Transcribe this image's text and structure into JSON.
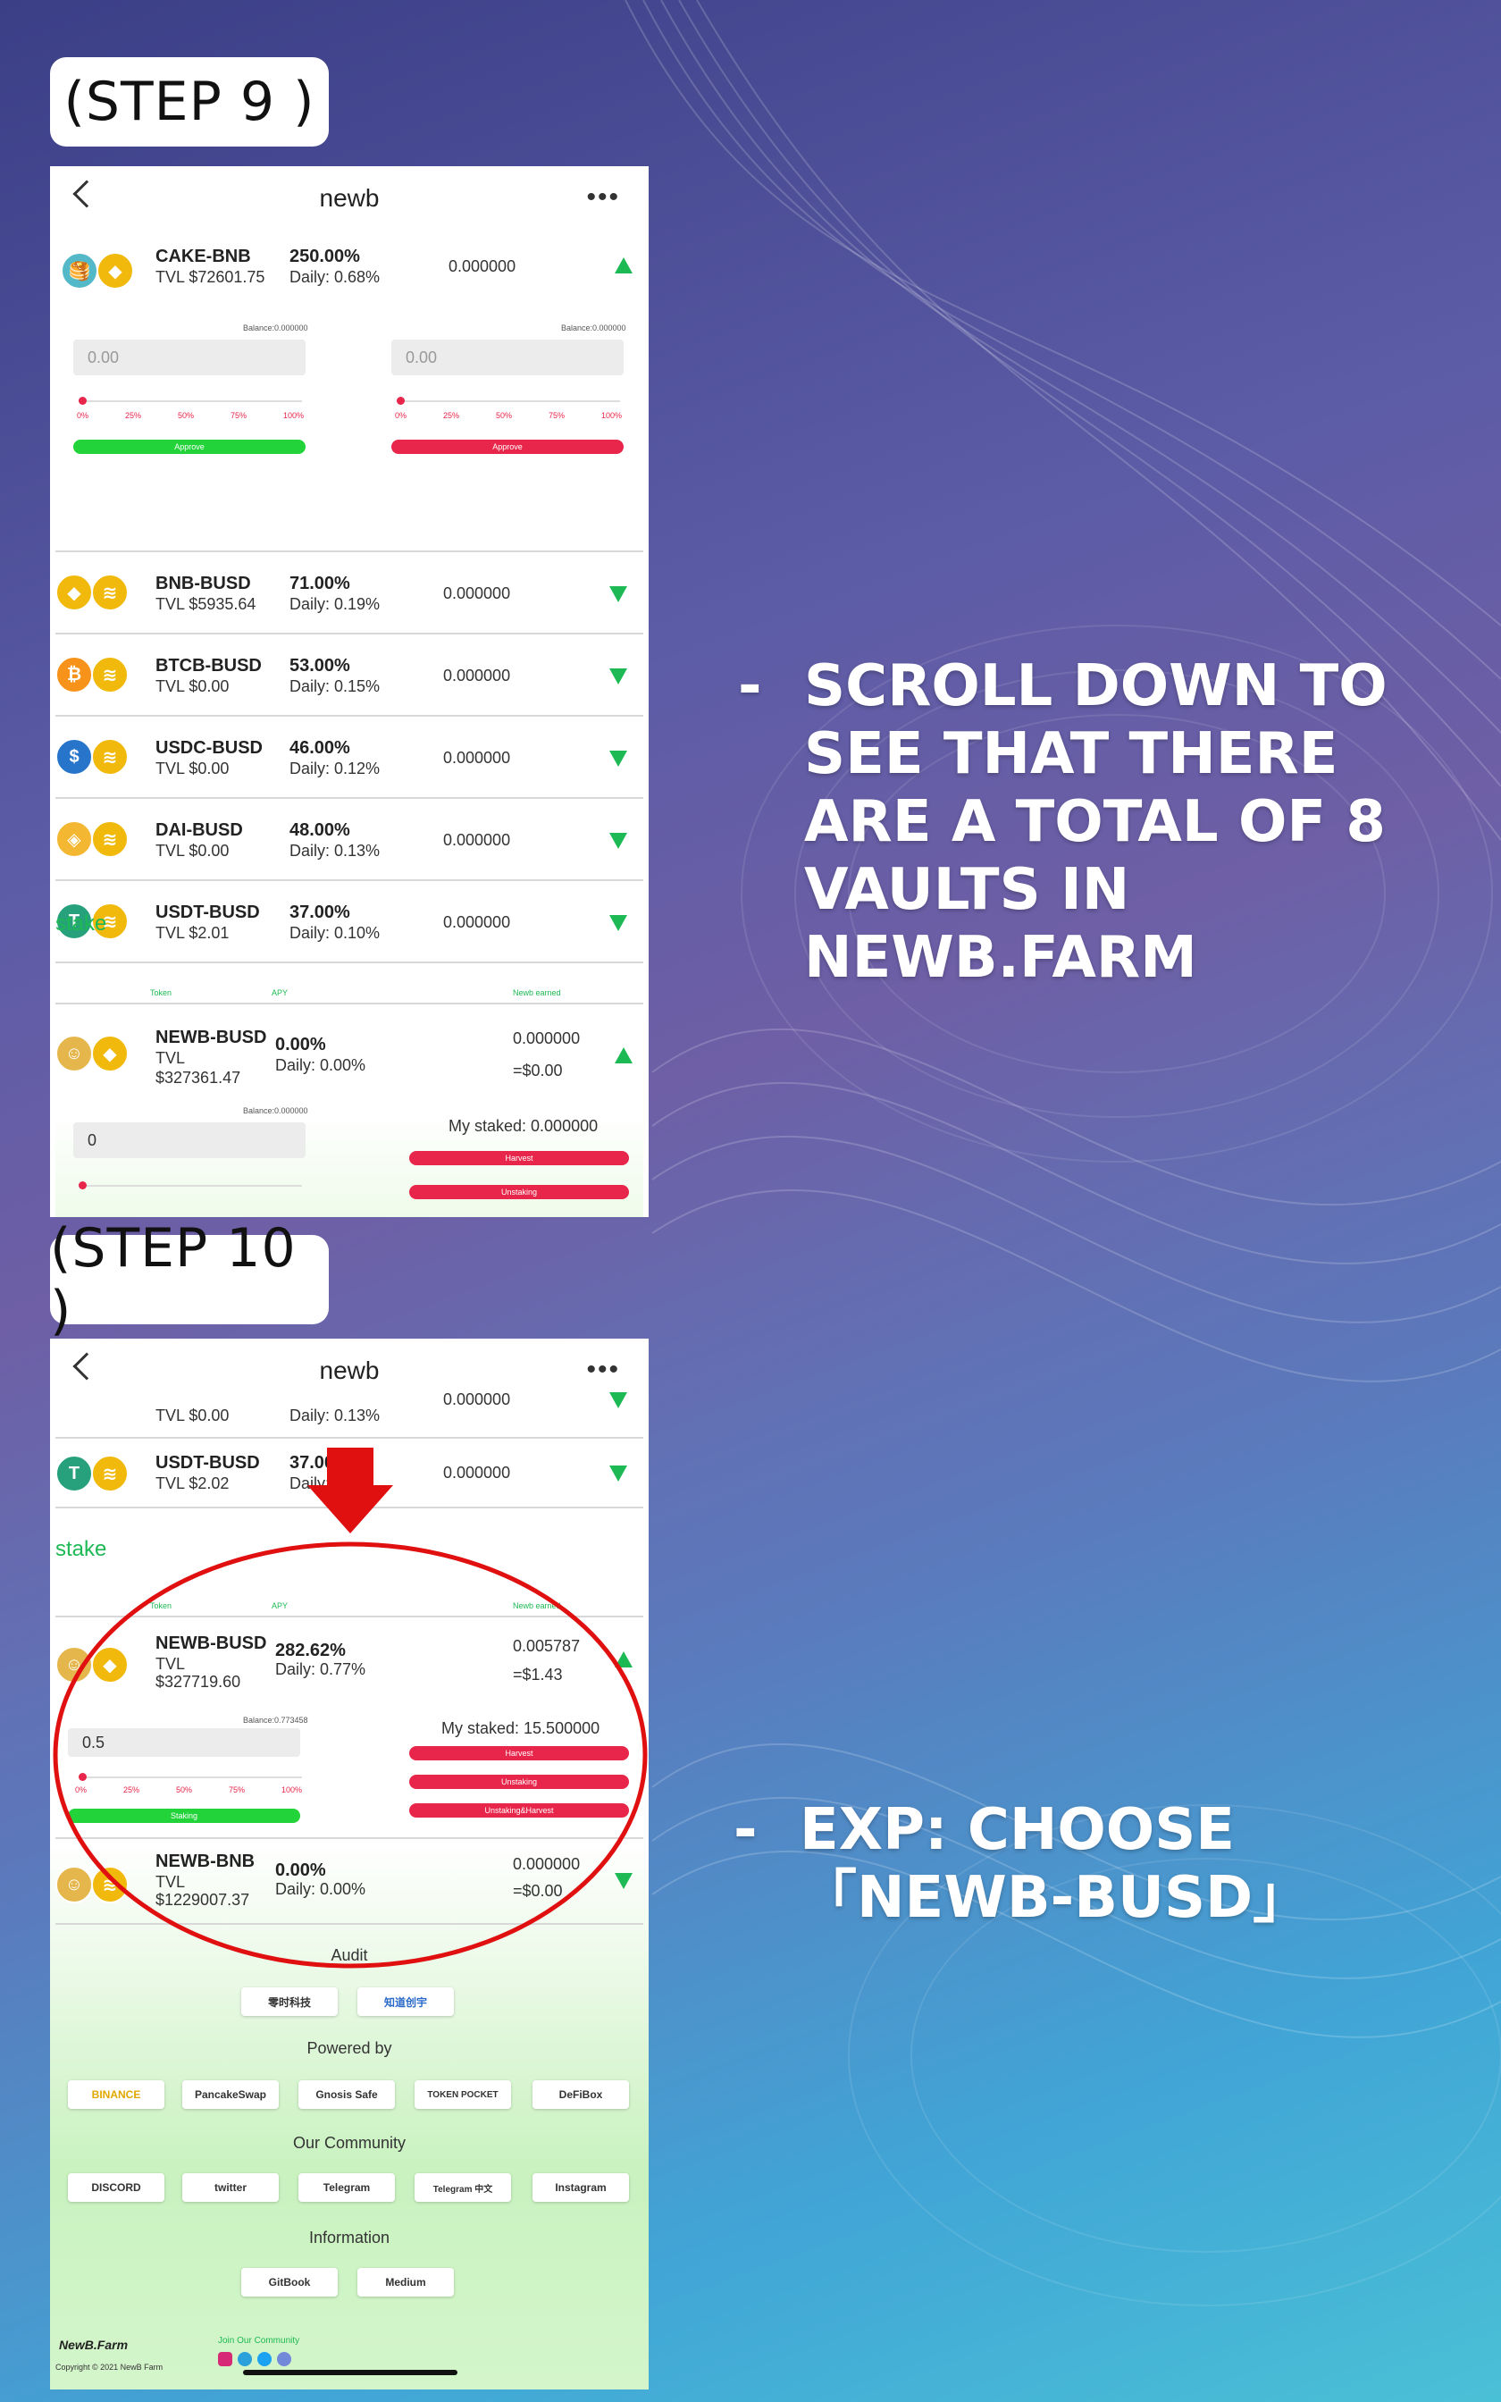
{
  "step9": {
    "label": "(STEP 9 )"
  },
  "step10": {
    "label": "(STEP 10 )"
  },
  "instruction1": {
    "dash": "-",
    "text": "SCROLL DOWN TO SEE THAT THERE ARE A TOTAL OF 8 VAULTS IN NEWB.FARM"
  },
  "instruction2": {
    "dash": "-",
    "text": "EXP: CHOOSE 「NEWB-BUSD」"
  },
  "app": {
    "title": "newb",
    "back_icon": "chevron-left-icon",
    "more_icon": "more-dots-icon"
  },
  "screen1": {
    "vaults": [
      {
        "pair": "CAKE-BNB",
        "tvl": "TVL $72601.75",
        "apy": "250.00%",
        "daily": "Daily: 0.68%",
        "amount": "0.000000",
        "expanded": true
      },
      {
        "pair": "BNB-BUSD",
        "tvl": "TVL $5935.64",
        "apy": "71.00%",
        "daily": "Daily: 0.19%",
        "amount": "0.000000"
      },
      {
        "pair": "BTCB-BUSD",
        "tvl": "TVL $0.00",
        "apy": "53.00%",
        "daily": "Daily: 0.15%",
        "amount": "0.000000"
      },
      {
        "pair": "USDC-BUSD",
        "tvl": "TVL $0.00",
        "apy": "46.00%",
        "daily": "Daily: 0.12%",
        "amount": "0.000000"
      },
      {
        "pair": "DAI-BUSD",
        "tvl": "TVL $0.00",
        "apy": "48.00%",
        "daily": "Daily: 0.13%",
        "amount": "0.000000"
      },
      {
        "pair": "USDT-BUSD",
        "tvl": "TVL $2.01",
        "apy": "37.00%",
        "daily": "Daily: 0.10%",
        "amount": "0.000000"
      }
    ],
    "expanded": {
      "balance_left": "Balance:0.000000",
      "balance_right": "Balance:0.000000",
      "input_left": "0.00",
      "input_right": "0.00",
      "ticks": [
        "0%",
        "25%",
        "50%",
        "75%",
        "100%"
      ],
      "approve_left": "Approve",
      "approve_right": "Approve"
    },
    "stake": {
      "title": "stake",
      "col_token": "Token",
      "col_apy": "APY",
      "col_earned": "Newb earned",
      "pair": "NEWB-BUSD",
      "tvl_label": "TVL",
      "tvl": "$327361.47",
      "apy": "0.00%",
      "daily": "Daily: 0.00%",
      "earned": "0.000000",
      "earned_usd": "=$0.00",
      "balance": "Balance:0.000000",
      "input": "0",
      "my_staked": "My staked: 0.000000",
      "harvest": "Harvest",
      "unstaking": "Unstaking"
    }
  },
  "screen2": {
    "partial": {
      "tvl": "TVL $0.00",
      "daily": "Daily: 0.13%",
      "amount": "0.000000"
    },
    "usdt": {
      "pair": "USDT-BUSD",
      "tvl": "TVL $2.02",
      "apy": "37.00",
      "daily": "Daily: 0",
      "amount": "0.000000"
    },
    "stake": {
      "title": "stake",
      "col_token": "Token",
      "col_apy": "APY",
      "col_earned": "Newb earned"
    },
    "newb_busd": {
      "pair": "NEWB-BUSD",
      "tvl_label": "TVL",
      "tvl": "$327719.60",
      "apy": "282.62%",
      "daily": "Daily: 0.77%",
      "earned": "0.005787",
      "earned_usd": "=$1.43",
      "balance": "Balance:0.773458",
      "input": "0.5",
      "my_staked": "My staked: 15.500000",
      "harvest": "Harvest",
      "unstaking": "Unstaking",
      "unstake_harvest": "Unstaking&Harvest",
      "staking": "Staking",
      "ticks": [
        "0%",
        "25%",
        "50%",
        "75%",
        "100%"
      ]
    },
    "newb_bnb": {
      "pair": "NEWB-BNB",
      "tvl_label": "TVL",
      "tvl": "$1229007.37",
      "apy": "0.00%",
      "daily": "Daily: 0.00%",
      "earned": "0.000000",
      "earned_usd": "=$0.00"
    },
    "footer": {
      "audit": "Audit",
      "auditors": [
        "零时科技",
        "知道创宇"
      ],
      "powered_by": "Powered by",
      "powered": [
        "BINANCE",
        "PancakeSwap",
        "Gnosis Safe",
        "TOKEN POCKET",
        "DeFiBox"
      ],
      "community": "Our Community",
      "communities": [
        "DISCORD",
        "twitter",
        "Telegram",
        "Telegram 中文",
        "Instagram"
      ],
      "information": "Information",
      "info_links": [
        "GitBook",
        "Medium"
      ],
      "brand": "NewB.Farm",
      "copyright": "Copyright © 2021 NewB Farm",
      "join": "Join Our Community"
    }
  },
  "colors": {
    "green": "#1db954",
    "red": "#e8254a",
    "approve_green": "#22d33a",
    "annotation_red": "#e01010"
  }
}
